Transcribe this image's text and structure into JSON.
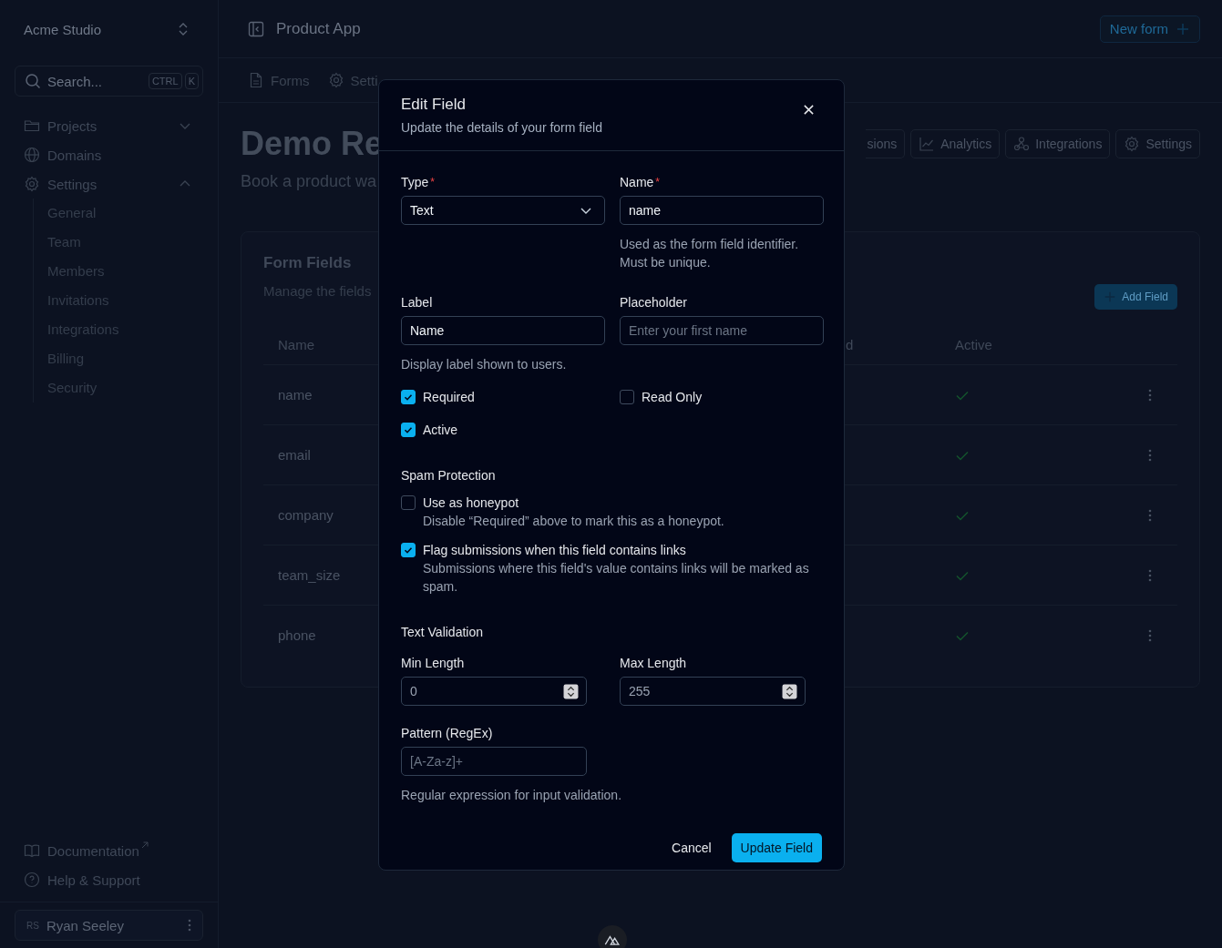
{
  "sidebar": {
    "workspace": "Acme Studio",
    "search": {
      "placeholder": "Search...",
      "shortcut": [
        "CTRL",
        "K"
      ]
    },
    "nav": [
      {
        "label": "Projects",
        "expanded": false
      },
      {
        "label": "Domains"
      },
      {
        "label": "Settings",
        "expanded": true,
        "children": [
          "General",
          "Team",
          "Members",
          "Invitations",
          "Integrations",
          "Billing",
          "Security"
        ]
      }
    ],
    "footer_links": [
      {
        "label": "Documentation",
        "external": true
      },
      {
        "label": "Help & Support",
        "external": false
      }
    ],
    "user": {
      "initials": "RS",
      "name": "Ryan Seeley"
    }
  },
  "header": {
    "title": "Product App",
    "new_button": "New form"
  },
  "tabs": [
    "Forms",
    "Setti"
  ],
  "page": {
    "title": "Demo Re",
    "subtitle": "Book a product wa",
    "toolbar": [
      "sions",
      "Analytics",
      "Integrations",
      "Settings"
    ]
  },
  "card": {
    "title": "Form Fields",
    "description": "Manage the fields",
    "add_button": "Add Field",
    "columns": [
      "Name",
      "d",
      "Active"
    ],
    "rows": [
      {
        "name": "name",
        "active": true
      },
      {
        "name": "email",
        "active": true
      },
      {
        "name": "company",
        "active": true
      },
      {
        "name": "team_size",
        "active": true
      },
      {
        "name": "phone",
        "active": true
      }
    ]
  },
  "dialog": {
    "title": "Edit Field",
    "subtitle": "Update the details of your form field",
    "type": {
      "label": "Type",
      "required_mark": "*",
      "value": "Text"
    },
    "name": {
      "label": "Name",
      "required_mark": "*",
      "value": "name",
      "hint": "Used as the form field identifier. Must be unique."
    },
    "label": {
      "label": "Label",
      "value": "Name",
      "hint": "Display label shown to users."
    },
    "placeholder": {
      "label": "Placeholder",
      "placeholder": "Enter your first name"
    },
    "options": [
      {
        "label": "Required",
        "checked": true
      },
      {
        "label": "Read Only",
        "checked": false
      },
      {
        "label": "Active",
        "checked": true
      }
    ],
    "spam": {
      "heading": "Spam Protection",
      "items": [
        {
          "label": "Use as honeypot",
          "description": "Disable “Required” above to mark this as a honeypot.",
          "checked": false
        },
        {
          "label": "Flag submissions when this field contains links",
          "description": "Submissions where this field's value contains links will be marked as spam.",
          "checked": true
        }
      ]
    },
    "validation": {
      "heading": "Text Validation",
      "min": {
        "label": "Min Length",
        "value": "0"
      },
      "max": {
        "label": "Max Length",
        "value": "255"
      },
      "pattern": {
        "label": "Pattern (RegEx)",
        "placeholder": "[A-Za-z]+",
        "hint": "Regular expression for input validation."
      }
    },
    "cancel": "Cancel",
    "submit": "Update Field"
  }
}
